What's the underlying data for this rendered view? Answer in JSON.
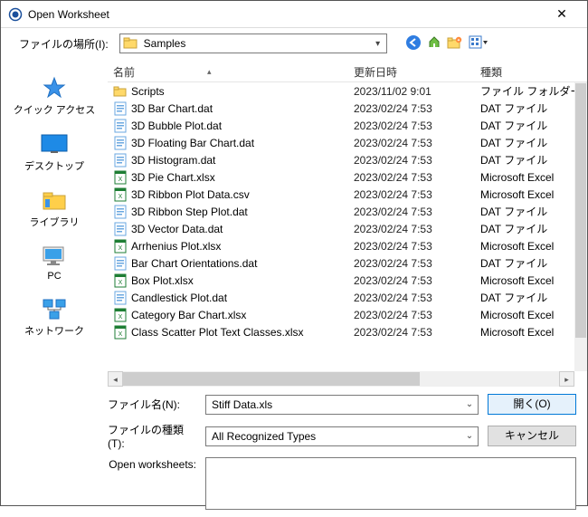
{
  "window": {
    "title": "Open Worksheet"
  },
  "toolbar": {
    "location_label": "ファイルの場所(I):",
    "current_folder": "Samples",
    "nav": {
      "back": "back-icon",
      "up": "up-icon",
      "newfolder": "new-folder-icon",
      "view": "view-menu-icon"
    }
  },
  "places": [
    {
      "label": "クイック アクセス",
      "kind": "quick"
    },
    {
      "label": "デスクトップ",
      "kind": "desktop"
    },
    {
      "label": "ライブラリ",
      "kind": "library"
    },
    {
      "label": "PC",
      "kind": "pc"
    },
    {
      "label": "ネットワーク",
      "kind": "network"
    }
  ],
  "columns": {
    "name": "名前",
    "date": "更新日時",
    "type": "種類"
  },
  "files": [
    {
      "icon": "folder",
      "name": "Scripts",
      "date": "2023/11/02 9:01",
      "type": "ファイル フォルダー"
    },
    {
      "icon": "dat",
      "name": "3D Bar Chart.dat",
      "date": "2023/02/24 7:53",
      "type": "DAT ファイル"
    },
    {
      "icon": "dat",
      "name": "3D Bubble Plot.dat",
      "date": "2023/02/24 7:53",
      "type": "DAT ファイル"
    },
    {
      "icon": "dat",
      "name": "3D Floating Bar Chart.dat",
      "date": "2023/02/24 7:53",
      "type": "DAT ファイル"
    },
    {
      "icon": "dat",
      "name": "3D Histogram.dat",
      "date": "2023/02/24 7:53",
      "type": "DAT ファイル"
    },
    {
      "icon": "xls",
      "name": "3D Pie Chart.xlsx",
      "date": "2023/02/24 7:53",
      "type": "Microsoft Excel "
    },
    {
      "icon": "csv",
      "name": "3D Ribbon Plot Data.csv",
      "date": "2023/02/24 7:53",
      "type": "Microsoft Excel "
    },
    {
      "icon": "dat",
      "name": "3D Ribbon Step Plot.dat",
      "date": "2023/02/24 7:53",
      "type": "DAT ファイル"
    },
    {
      "icon": "dat",
      "name": "3D Vector Data.dat",
      "date": "2023/02/24 7:53",
      "type": "DAT ファイル"
    },
    {
      "icon": "xls",
      "name": "Arrhenius Plot.xlsx",
      "date": "2023/02/24 7:53",
      "type": "Microsoft Excel "
    },
    {
      "icon": "dat",
      "name": "Bar Chart Orientations.dat",
      "date": "2023/02/24 7:53",
      "type": "DAT ファイル"
    },
    {
      "icon": "xls",
      "name": "Box Plot.xlsx",
      "date": "2023/02/24 7:53",
      "type": "Microsoft Excel "
    },
    {
      "icon": "dat",
      "name": "Candlestick Plot.dat",
      "date": "2023/02/24 7:53",
      "type": "DAT ファイル"
    },
    {
      "icon": "xls",
      "name": "Category Bar Chart.xlsx",
      "date": "2023/02/24 7:53",
      "type": "Microsoft Excel "
    },
    {
      "icon": "xls",
      "name": "Class Scatter Plot Text Classes.xlsx",
      "date": "2023/02/24 7:53",
      "type": "Microsoft Excel "
    }
  ],
  "filename": {
    "label": "ファイル名(N):",
    "value": "Stiff Data.xls"
  },
  "filetype": {
    "label": "ファイルの種類(T):",
    "value": "All Recognized Types"
  },
  "buttons": {
    "open": "開く(O)",
    "cancel": "キャンセル"
  },
  "open_worksheets_label": "Open worksheets:"
}
